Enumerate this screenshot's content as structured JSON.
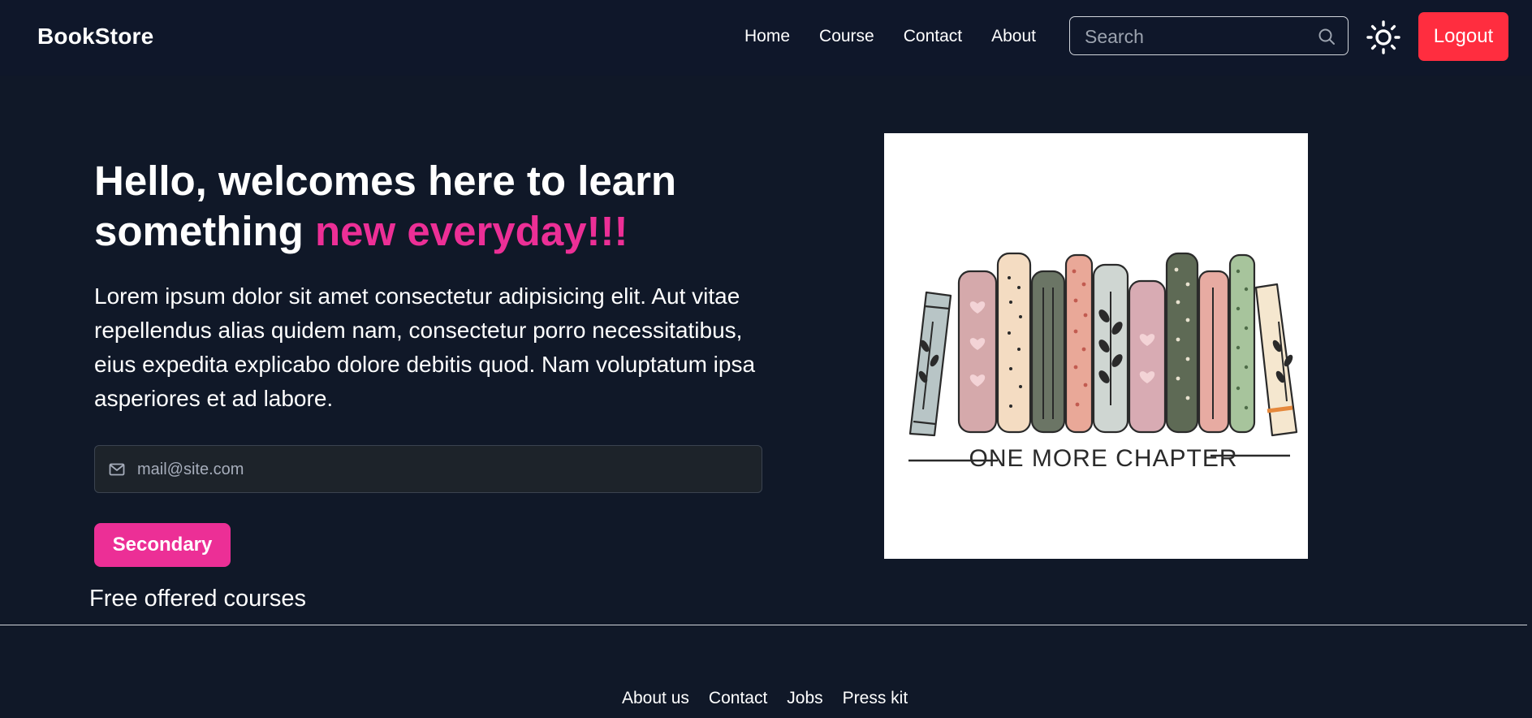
{
  "navbar": {
    "brand": "BookStore",
    "links": [
      "Home",
      "Course",
      "Contact",
      "About"
    ],
    "search": {
      "placeholder": "Search",
      "value": ""
    },
    "theme_toggle_icon": "sun-icon",
    "logout_label": "Logout"
  },
  "hero": {
    "title_main": "Hello, welcomes here to learn something ",
    "title_accent": "new everyday!!!",
    "description": "Lorem ipsum dolor sit amet consectetur adipisicing elit. Aut vitae repellendus alias quidem nam, consectetur porro necessitatibus, eius expedita explicabo dolore debitis quod. Nam voluptatum ipsa asperiores et ad labore.",
    "email": {
      "placeholder": "mail@site.com",
      "value": "",
      "icon": "mail-icon"
    },
    "button_label": "Secondary",
    "image_caption": "ONE MORE CHAPTER"
  },
  "section": {
    "heading": "Free offered courses"
  },
  "footer": {
    "links": [
      "About us",
      "Contact",
      "Jobs",
      "Press kit"
    ]
  },
  "colors": {
    "background": "#101828",
    "accent_pink": "#ec2f96",
    "logout_red": "#ff2d3f"
  }
}
